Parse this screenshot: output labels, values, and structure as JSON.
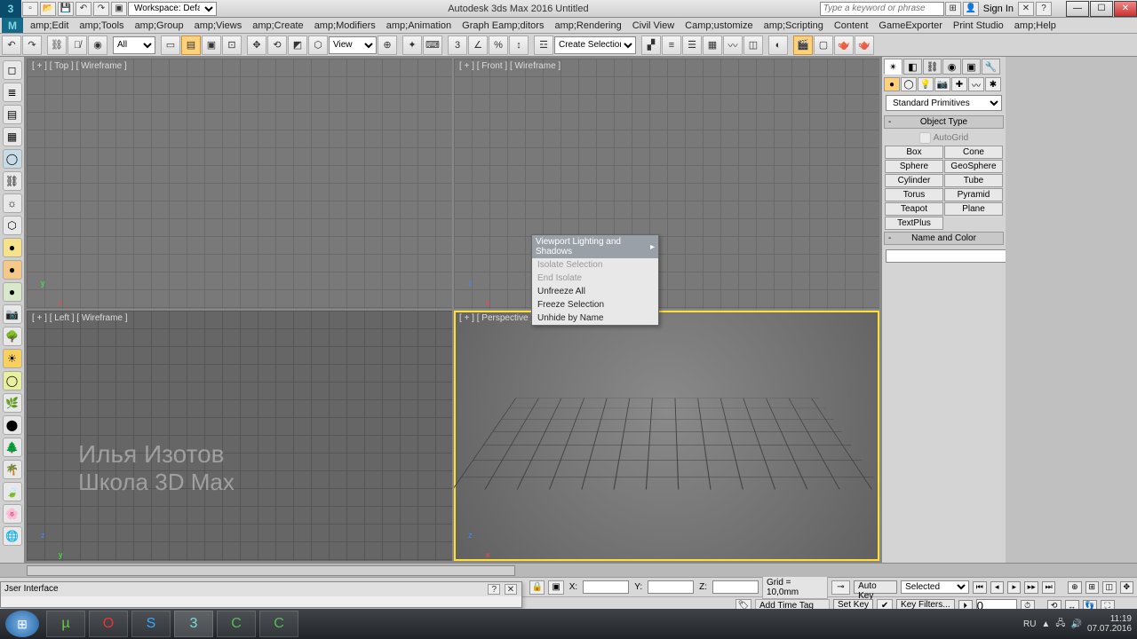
{
  "title": "Autodesk 3ds Max 2016   Untitled",
  "workspace": {
    "label": "Workspace: Default"
  },
  "search_placeholder": "Type a keyword or phrase",
  "signin": "Sign In",
  "menus": [
    "amp;Edit",
    "amp;Tools",
    "amp;Group",
    "amp;Views",
    "amp;Create",
    "amp;Modifiers",
    "amp;Animation",
    "Graph Eamp;ditors",
    "amp;Rendering",
    "Civil View",
    "Camp;ustomize",
    "amp;Scripting",
    "Content",
    "GameExporter",
    "Print Studio",
    "amp;Help"
  ],
  "toolbar": {
    "filter": "All",
    "ref": "View",
    "sel_set": "Create Selection Se"
  },
  "viewports": {
    "top": "[ + ] [ Top ] [ Wireframe ]",
    "front": "[ + ] [ Front ] [ Wireframe ]",
    "left": "[ + ] [ Left ] [ Wireframe ]",
    "persp": "[ + ] [ Perspective ] [ Smooth + Highlights ]"
  },
  "ctx": {
    "header": "Viewport Lighting and Shadows",
    "items": [
      {
        "t": "Isolate Selection",
        "d": true
      },
      {
        "t": "End Isolate",
        "d": true
      },
      {
        "t": "Unfreeze All",
        "d": false
      },
      {
        "t": "Freeze Selection",
        "d": false
      },
      {
        "t": "Unhide by Name",
        "d": false
      }
    ]
  },
  "cmd": {
    "category": "Standard Primitives",
    "roll1": "Object Type",
    "autogrid": "AutoGrid",
    "prims": [
      "Box",
      "Cone",
      "Sphere",
      "GeoSphere",
      "Cylinder",
      "Tube",
      "Torus",
      "Pyramid",
      "Teapot",
      "Plane",
      "TextPlus",
      ""
    ],
    "roll2": "Name and Color"
  },
  "status": {
    "x": "X:",
    "y": "Y:",
    "z": "Z:",
    "grid": "Grid = 10,0mm",
    "autokey": "Auto Key",
    "selected": "Selected",
    "setkey": "Set Key",
    "keyfilters": "Key Filters...",
    "addtag": "Add Time Tag",
    "frame": "0"
  },
  "float": {
    "title": "Jser Interface"
  },
  "tray": {
    "lang": "RU",
    "time": "11:19",
    "date": "07.07.2016"
  },
  "watermark": {
    "l1": "Илья Изотов",
    "l2": "Школа 3D Max"
  }
}
